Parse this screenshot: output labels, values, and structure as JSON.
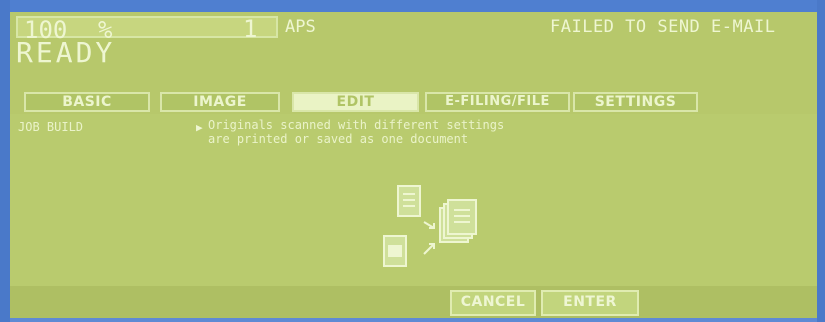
{
  "status": {
    "zoom_value": "100",
    "zoom_unit": "%",
    "copies": "1",
    "paper_mode": "APS",
    "alert": "FAILED TO SEND E-MAIL",
    "state": "READY"
  },
  "tabs": [
    {
      "label": "BASIC",
      "active": false
    },
    {
      "label": "IMAGE",
      "active": false
    },
    {
      "label": "EDIT",
      "active": true
    },
    {
      "label": "E-FILING/FILE",
      "active": false
    },
    {
      "label": "SETTINGS",
      "active": false
    }
  ],
  "content": {
    "title": "JOB BUILD",
    "description_line1": "Originals scanned with different settings",
    "description_line2": "are printed or saved as one document"
  },
  "buttons": {
    "cancel": "CANCEL",
    "enter": "ENTER"
  },
  "colors": {
    "screen_bg": "#b7c86b",
    "text": "#eef6d1",
    "active_tab": "#eaf3c5"
  }
}
